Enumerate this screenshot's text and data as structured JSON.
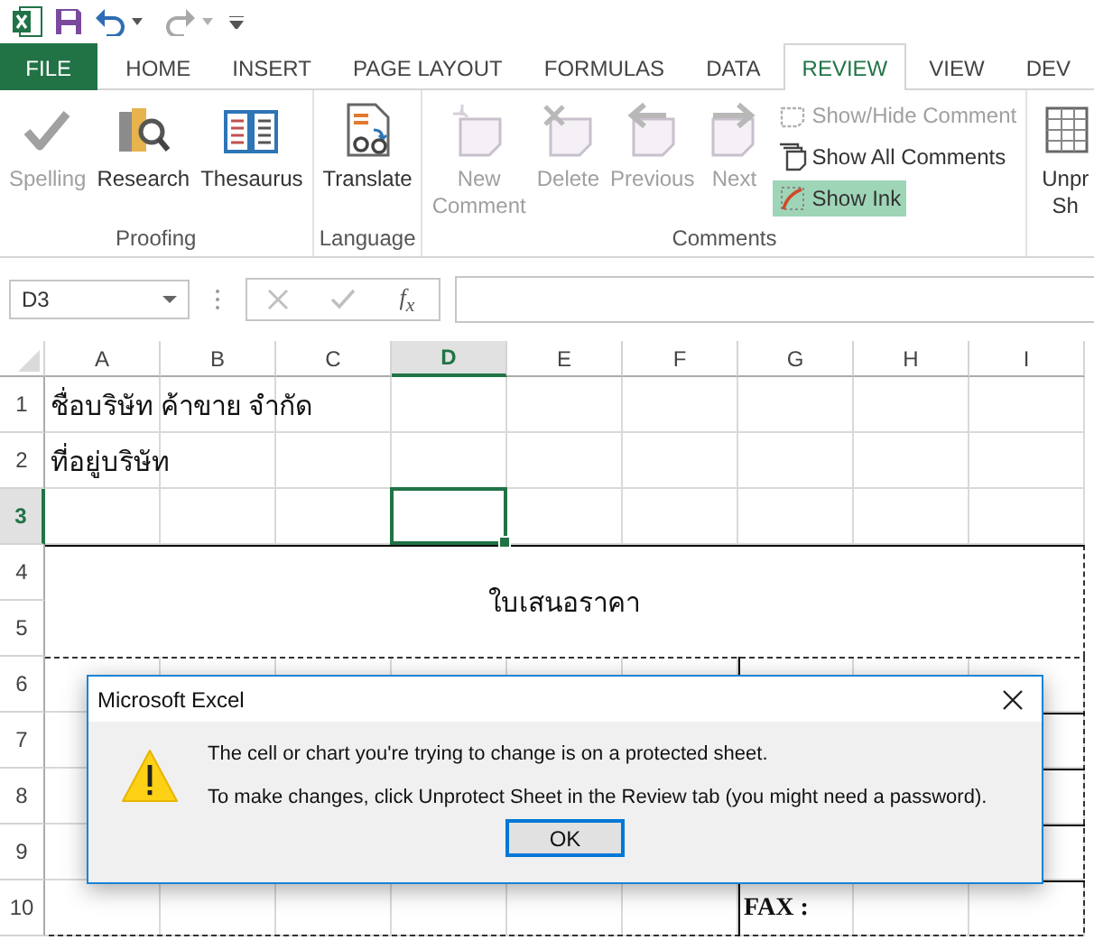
{
  "tabs": [
    {
      "label": "FILE",
      "kind": "file",
      "selected": false
    },
    {
      "label": "HOME",
      "kind": "tab",
      "selected": false
    },
    {
      "label": "INSERT",
      "kind": "tab",
      "selected": false
    },
    {
      "label": "PAGE LAYOUT",
      "kind": "tab",
      "selected": false
    },
    {
      "label": "FORMULAS",
      "kind": "tab",
      "selected": false
    },
    {
      "label": "DATA",
      "kind": "tab",
      "selected": false
    },
    {
      "label": "REVIEW",
      "kind": "tab",
      "selected": true
    },
    {
      "label": "VIEW",
      "kind": "tab",
      "selected": false
    },
    {
      "label": "DEV",
      "kind": "tab",
      "selected": false
    }
  ],
  "ribbon": {
    "groups": [
      {
        "label": "Proofing",
        "buttons": [
          {
            "lines": [
              "Spelling"
            ],
            "disabled": true
          },
          {
            "lines": [
              "Research"
            ],
            "disabled": false
          },
          {
            "lines": [
              "Thesaurus"
            ],
            "disabled": false
          }
        ]
      },
      {
        "label": "Language",
        "buttons": [
          {
            "lines": [
              "Translate"
            ],
            "disabled": false
          }
        ]
      },
      {
        "label": "Comments",
        "buttons": [
          {
            "lines": [
              "New",
              "Comment"
            ],
            "disabled": true
          },
          {
            "lines": [
              "Delete"
            ],
            "disabled": true
          },
          {
            "lines": [
              "Previous"
            ],
            "disabled": true
          },
          {
            "lines": [
              "Next"
            ],
            "disabled": true
          }
        ],
        "small_buttons": [
          {
            "label": "Show/Hide Comment",
            "disabled": true,
            "selected": false
          },
          {
            "label": "Show All Comments",
            "disabled": false,
            "selected": false
          },
          {
            "label": "Show Ink",
            "disabled": false,
            "selected": true
          }
        ]
      },
      {
        "buttons": [
          {
            "lines": [
              "Unpr",
              "Sh"
            ],
            "disabled": false
          }
        ]
      }
    ]
  },
  "formula_bar": {
    "name_box": "D3",
    "function_label": "f$_{x}$"
  },
  "sheet": {
    "columns": [
      {
        "label": "A",
        "selected": false
      },
      {
        "label": "B",
        "selected": false
      },
      {
        "label": "C",
        "selected": false
      },
      {
        "label": "D",
        "selected": true
      },
      {
        "label": "E",
        "selected": false
      },
      {
        "label": "F",
        "selected": false
      },
      {
        "label": "G",
        "selected": false
      },
      {
        "label": "H",
        "selected": false
      },
      {
        "label": "I",
        "selected": false
      }
    ],
    "rows": [
      {
        "label": "1",
        "selected": false,
        "cells": {
          "A": {
            "text": "ชื่อบริษัท ค้าขาย จำกัด",
            "bold": false,
            "merged": false
          }
        }
      },
      {
        "label": "2",
        "selected": false,
        "cells": {
          "A": {
            "text": "ที่อยู่บริษัท",
            "bold": false,
            "merged": false
          }
        }
      },
      {
        "label": "3",
        "selected": true
      },
      {
        "label": "4",
        "selected": false,
        "cells": {
          "A": {
            "text": "ใบเสนอราคา",
            "bold": false,
            "merged": true
          }
        }
      },
      {
        "label": "5",
        "selected": false
      },
      {
        "label": "6",
        "selected": false
      },
      {
        "label": "7",
        "selected": false
      },
      {
        "label": "8",
        "selected": false
      },
      {
        "label": "9",
        "selected": false
      },
      {
        "label": "10",
        "selected": false,
        "cells": {
          "G": {
            "text": "FAX :",
            "bold": true,
            "merged": false
          }
        }
      }
    ]
  },
  "dialog": {
    "title": "Microsoft Excel",
    "messages": [
      "The cell or chart you're trying to change is on a protected sheet.",
      "To make changes, click Unprotect Sheet in the Review tab (you might need a password)."
    ],
    "button": "OK"
  }
}
